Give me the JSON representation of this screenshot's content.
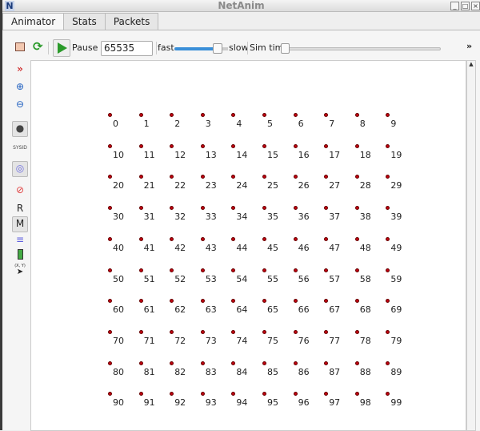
{
  "window": {
    "title": "NetAnim",
    "app_icon": "N",
    "minimize": "_",
    "maximize": "□",
    "close": "×"
  },
  "tabs": [
    {
      "label": "Animator",
      "active": true
    },
    {
      "label": "Stats"
    },
    {
      "label": "Packets"
    }
  ],
  "toolbar": {
    "pause_label": "Pause At",
    "pause_value": "65535",
    "fast_label": "fast",
    "slow_label": "slow",
    "speed_fraction": 0.85,
    "sim_time_label": "Sim time",
    "sim_time_fraction": 0,
    "more": "»"
  },
  "sidebar": {
    "r_label": "R",
    "m_label": "M",
    "sysid_label": "SYSID",
    "xy_label": "(X, Y)"
  },
  "nodes": [
    "0",
    "1",
    "2",
    "3",
    "4",
    "5",
    "6",
    "7",
    "8",
    "9",
    "10",
    "11",
    "12",
    "13",
    "14",
    "15",
    "16",
    "17",
    "18",
    "19",
    "20",
    "21",
    "22",
    "23",
    "24",
    "25",
    "26",
    "27",
    "28",
    "29",
    "30",
    "31",
    "32",
    "33",
    "34",
    "35",
    "36",
    "37",
    "38",
    "39",
    "40",
    "41",
    "42",
    "43",
    "44",
    "45",
    "46",
    "47",
    "48",
    "49",
    "50",
    "51",
    "52",
    "53",
    "54",
    "55",
    "56",
    "57",
    "58",
    "59",
    "60",
    "61",
    "62",
    "63",
    "64",
    "65",
    "66",
    "67",
    "68",
    "69",
    "70",
    "71",
    "72",
    "73",
    "74",
    "75",
    "76",
    "77",
    "78",
    "79",
    "80",
    "81",
    "82",
    "83",
    "84",
    "85",
    "86",
    "87",
    "88",
    "89",
    "90",
    "91",
    "92",
    "93",
    "94",
    "95",
    "96",
    "97",
    "98",
    "99"
  ],
  "colors": {
    "node": "#c00010",
    "speed_slider": "#3a8fd8",
    "play": "#2a9a2a"
  }
}
